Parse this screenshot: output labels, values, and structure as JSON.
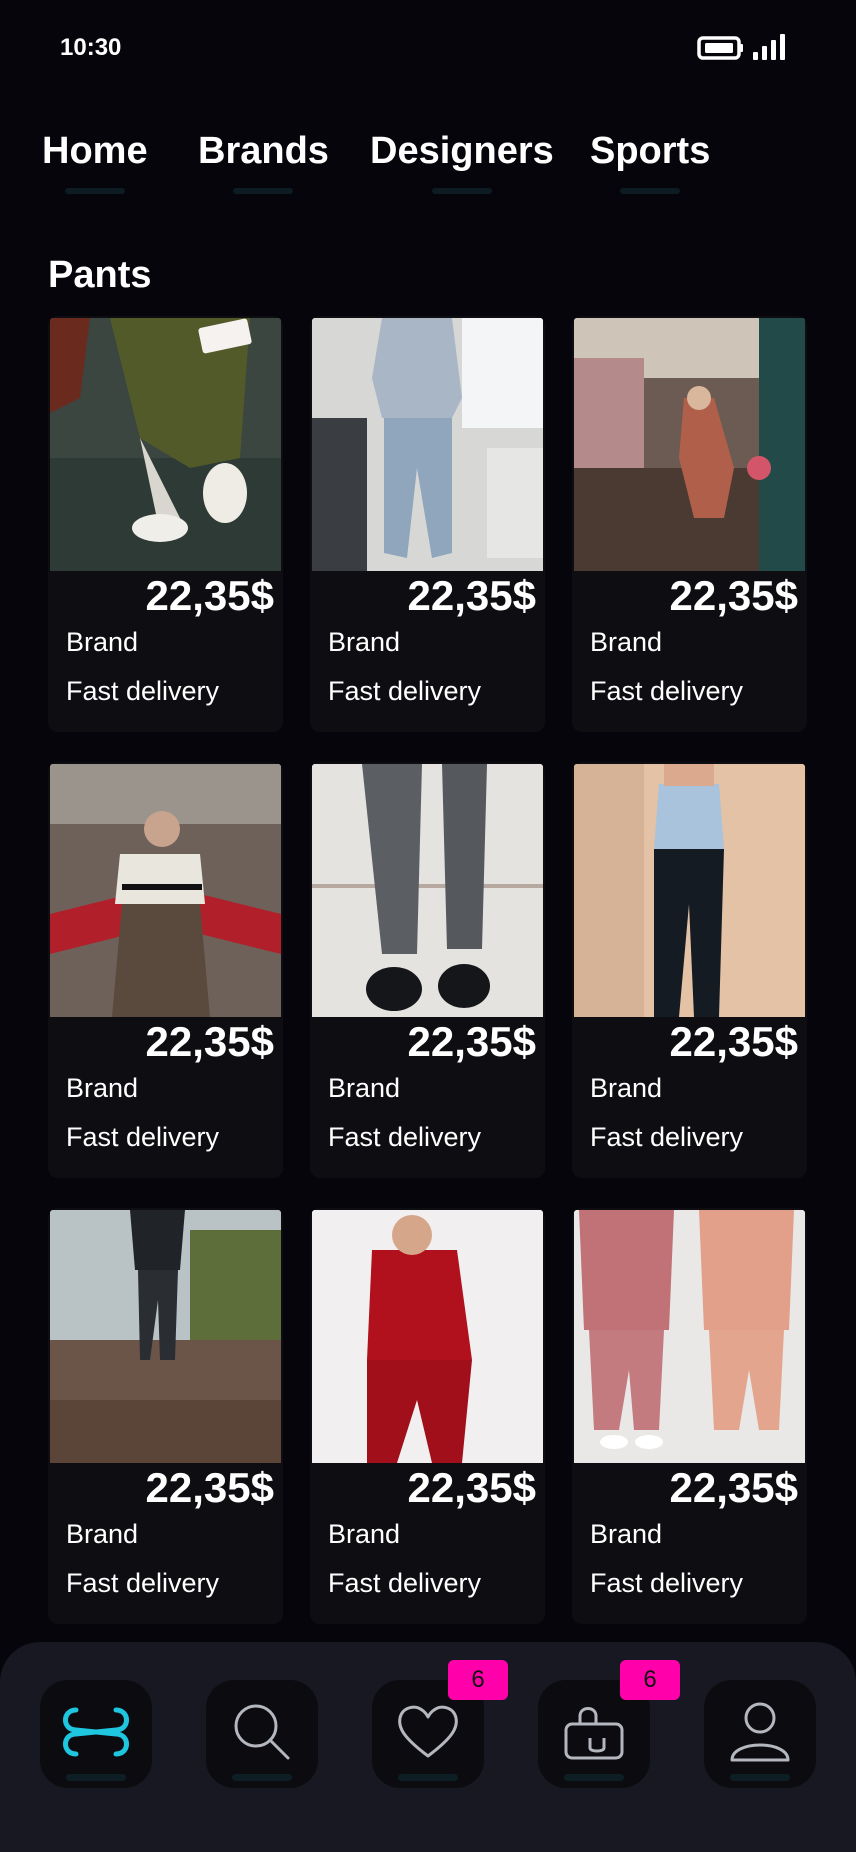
{
  "status_bar": {
    "time": "10:30"
  },
  "tabs": [
    {
      "label": "Home"
    },
    {
      "label": "Brands"
    },
    {
      "label": "Designers"
    },
    {
      "label": "Sports"
    }
  ],
  "section": {
    "title": "Pants"
  },
  "products": [
    {
      "price": "22,35$",
      "brand": "Brand",
      "delivery": "Fast delivery"
    },
    {
      "price": "22,35$",
      "brand": "Brand",
      "delivery": "Fast delivery"
    },
    {
      "price": "22,35$",
      "brand": "Brand",
      "delivery": "Fast delivery"
    },
    {
      "price": "22,35$",
      "brand": "Brand",
      "delivery": "Fast delivery"
    },
    {
      "price": "22,35$",
      "brand": "Brand",
      "delivery": "Fast delivery"
    },
    {
      "price": "22,35$",
      "brand": "Brand",
      "delivery": "Fast delivery"
    },
    {
      "price": "22,35$",
      "brand": "Brand",
      "delivery": "Fast delivery"
    },
    {
      "price": "22,35$",
      "brand": "Brand",
      "delivery": "Fast delivery"
    },
    {
      "price": "22,35$",
      "brand": "Brand",
      "delivery": "Fast delivery"
    }
  ],
  "bottom_nav": {
    "items": [
      {
        "icon": "logo-icon"
      },
      {
        "icon": "search-icon"
      },
      {
        "icon": "heart-icon",
        "badge": "6"
      },
      {
        "icon": "shopping-bag-icon",
        "badge": "6"
      },
      {
        "icon": "profile-icon"
      }
    ]
  },
  "colors": {
    "accent": "#1ec6e0",
    "badge": "#ff00aa",
    "background": "#05050b"
  }
}
